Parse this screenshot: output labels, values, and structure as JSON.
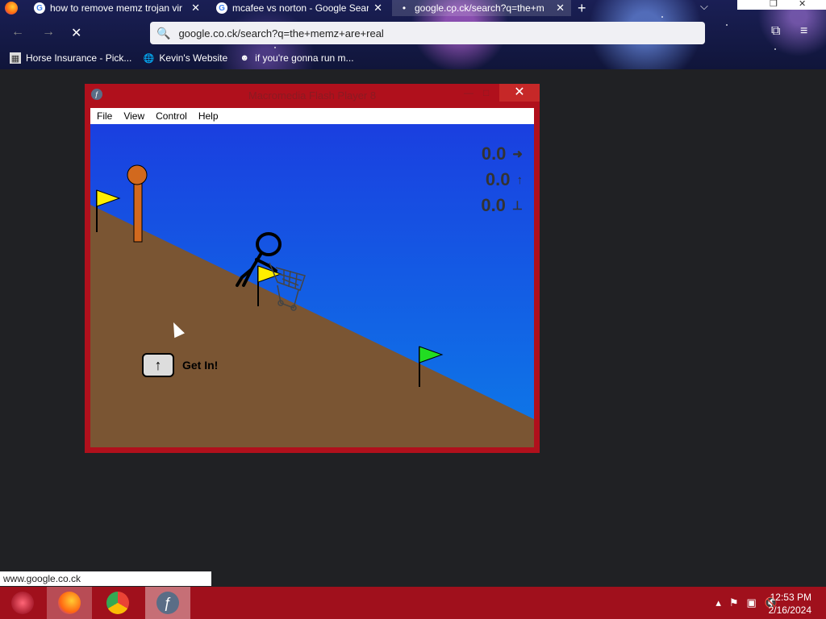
{
  "browser": {
    "tabs": [
      {
        "title": "how to remove memz trojan vir",
        "close": "✕"
      },
      {
        "title": "mcafee vs norton - Google Sear",
        "close": "✕"
      },
      {
        "title": "google.co.ck/search?q=the+m",
        "close": "✕"
      }
    ],
    "new_tab": "+",
    "url": "google.co.ck/search?q=the+memz+are+real",
    "bookmarks": [
      {
        "label": "Horse Insurance - Pick..."
      },
      {
        "label": "Kevin's Website"
      },
      {
        "label": "if you're gonna run m..."
      }
    ],
    "status_url": "www.google.co.ck"
  },
  "flash_window": {
    "title": "Macromedia Flash Player 8",
    "menu": [
      "File",
      "View",
      "Control",
      "Help"
    ],
    "close": "✕"
  },
  "game": {
    "stats": [
      {
        "value": "0.0",
        "icon": "right-arrow-icon",
        "glyph": "➜"
      },
      {
        "value": "0.0",
        "icon": "up-arrow-icon",
        "glyph": "↑"
      },
      {
        "value": "0.0",
        "icon": "ground-icon",
        "glyph": "⊥"
      }
    ],
    "key": "↑",
    "prompt": "Get In!",
    "colors": {
      "sky": "#1a3fe0",
      "ground": "#7a5533",
      "flag_yellow": "#ffee00",
      "flag_green": "#22dd22",
      "pole": "#d2691e"
    }
  },
  "taskbar": {
    "time": "12:53 PM",
    "date": "2/16/2024"
  }
}
